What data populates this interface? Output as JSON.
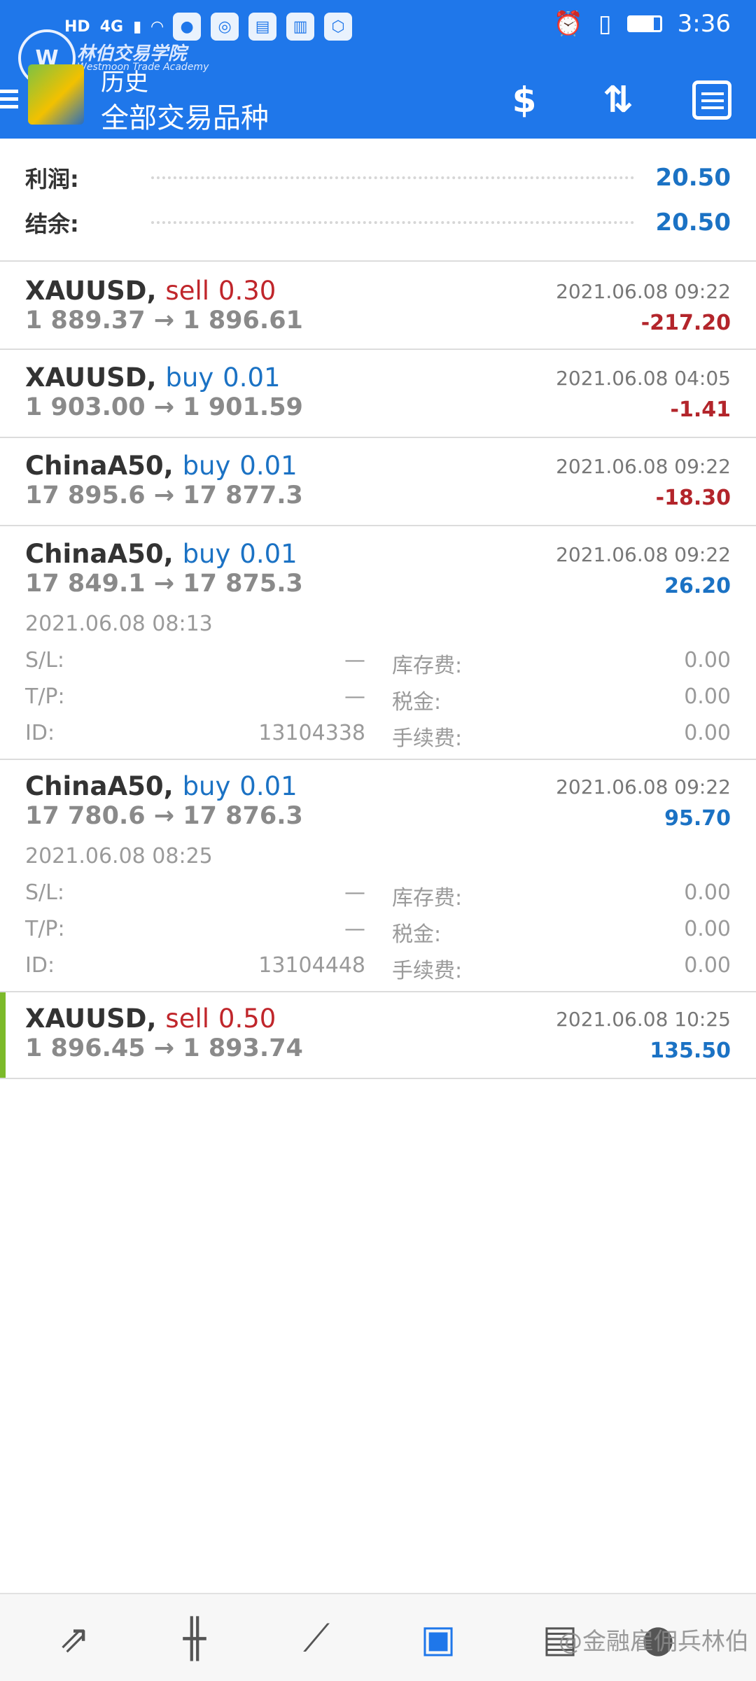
{
  "status": {
    "left_icons": [
      "HD",
      "4G"
    ],
    "time": "3:36"
  },
  "watermark": {
    "logo_letter": "W",
    "title": "林伯交易学院",
    "subtitle": "Westmoon Trade Academy",
    "bottom": "@金融雇佣兵林伯"
  },
  "header": {
    "subtitle": "历史",
    "title": "全部交易品种"
  },
  "summary": {
    "profit_label": "利润:",
    "profit_value": "20.50",
    "balance_label": "结余:",
    "balance_value": "20.50"
  },
  "trades": [
    {
      "symbol": "XAUUSD,",
      "side": "sell",
      "volume": "0.30",
      "time": "2021.06.08 09:22",
      "prices": "1 889.37 → 1 896.61",
      "profit": "-217.20"
    },
    {
      "symbol": "XAUUSD,",
      "side": "buy",
      "volume": "0.01",
      "time": "2021.06.08 04:05",
      "prices": "1 903.00 → 1 901.59",
      "profit": "-1.41"
    },
    {
      "symbol": "ChinaA50,",
      "side": "buy",
      "volume": "0.01",
      "time": "2021.06.08 09:22",
      "prices": "17 895.6 → 17 877.3",
      "profit": "-18.30"
    },
    {
      "symbol": "ChinaA50,",
      "side": "buy",
      "volume": "0.01",
      "time": "2021.06.08 09:22",
      "prices": "17 849.1 → 17 875.3",
      "profit": "26.20",
      "open_time": "2021.06.08 08:13",
      "sl_label": "S/L:",
      "sl": "—",
      "tp_label": "T/P:",
      "tp": "—",
      "id_label": "ID:",
      "id": "13104338",
      "swap_label": "库存费:",
      "swap": "0.00",
      "tax_label": "税金:",
      "tax": "0.00",
      "fee_label": "手续费:",
      "fee": "0.00"
    },
    {
      "symbol": "ChinaA50,",
      "side": "buy",
      "volume": "0.01",
      "time": "2021.06.08 09:22",
      "prices": "17 780.6 → 17 876.3",
      "profit": "95.70",
      "open_time": "2021.06.08 08:25",
      "sl_label": "S/L:",
      "sl": "—",
      "tp_label": "T/P:",
      "tp": "—",
      "id_label": "ID:",
      "id": "13104448",
      "swap_label": "库存费:",
      "swap": "0.00",
      "tax_label": "税金:",
      "tax": "0.00",
      "fee_label": "手续费:",
      "fee": "0.00"
    },
    {
      "symbol": "XAUUSD,",
      "side": "sell",
      "volume": "0.50",
      "time": "2021.06.08 10:25",
      "prices": "1 896.45 → 1 893.74",
      "profit": "135.50"
    }
  ],
  "colors": {
    "appbar": "#1f77ea",
    "sell": "#c0262b",
    "buy": "#1b72c4",
    "active_row": "#7cba2a"
  }
}
